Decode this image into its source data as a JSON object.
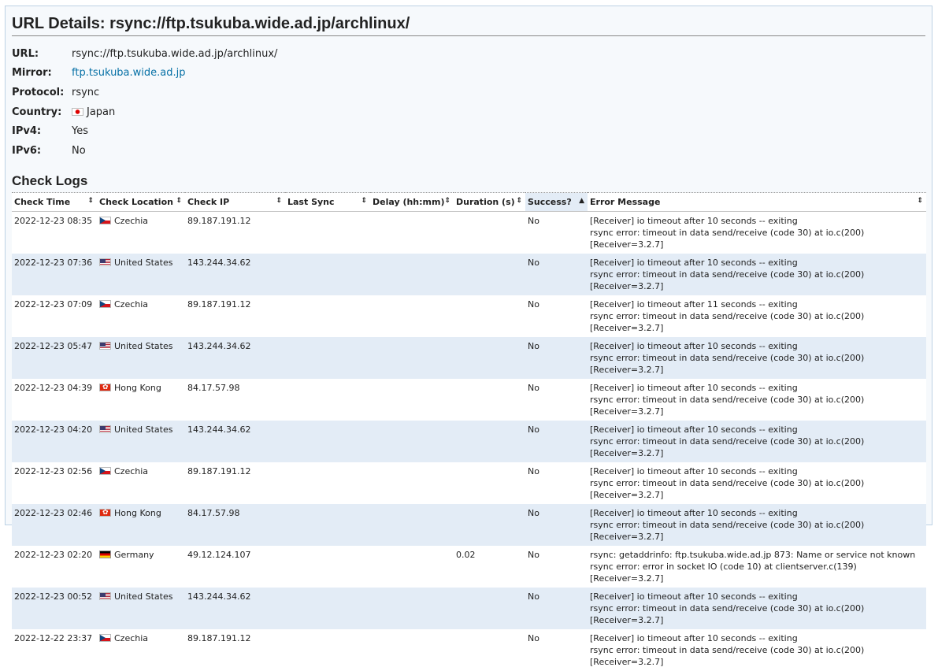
{
  "title": "URL Details: rsync://ftp.tsukuba.wide.ad.jp/archlinux/",
  "details": {
    "url_label": "URL:",
    "url": "rsync://ftp.tsukuba.wide.ad.jp/archlinux/",
    "mirror_label": "Mirror:",
    "mirror": "ftp.tsukuba.wide.ad.jp",
    "protocol_label": "Protocol:",
    "protocol": "rsync",
    "country_label": "Country:",
    "country": "Japan",
    "country_flag": "jp-flag-icon",
    "ipv4_label": "IPv4:",
    "ipv4": "Yes",
    "ipv6_label": "IPv6:",
    "ipv6": "No"
  },
  "check_logs": {
    "title": "Check Logs",
    "columns": [
      "Check Time",
      "Check Location",
      "Check IP",
      "Last Sync",
      "Delay (hh:mm)",
      "Duration (s)",
      "Success?",
      "Error Message"
    ],
    "sort_icon": "⇕ / ▲",
    "rows": [
      {
        "time": "2022-12-23 08:35",
        "flag": "cz",
        "location": "Czechia",
        "ip": "89.187.191.12",
        "last_sync": "",
        "delay": "",
        "duration": "",
        "success": "No",
        "err1": "[Receiver] io timeout after 10 seconds -- exiting",
        "err2": "rsync error: timeout in data send/receive (code 30) at io.c(200) [Receiver=3.2.7]"
      },
      {
        "time": "2022-12-23 07:36",
        "flag": "us",
        "location": "United States",
        "ip": "143.244.34.62",
        "last_sync": "",
        "delay": "",
        "duration": "",
        "success": "No",
        "err1": "[Receiver] io timeout after 10 seconds -- exiting",
        "err2": "rsync error: timeout in data send/receive (code 30) at io.c(200) [Receiver=3.2.7]"
      },
      {
        "time": "2022-12-23 07:09",
        "flag": "cz",
        "location": "Czechia",
        "ip": "89.187.191.12",
        "last_sync": "",
        "delay": "",
        "duration": "",
        "success": "No",
        "err1": "[Receiver] io timeout after 11 seconds -- exiting",
        "err2": "rsync error: timeout in data send/receive (code 30) at io.c(200) [Receiver=3.2.7]"
      },
      {
        "time": "2022-12-23 05:47",
        "flag": "us",
        "location": "United States",
        "ip": "143.244.34.62",
        "last_sync": "",
        "delay": "",
        "duration": "",
        "success": "No",
        "err1": "[Receiver] io timeout after 10 seconds -- exiting",
        "err2": "rsync error: timeout in data send/receive (code 30) at io.c(200) [Receiver=3.2.7]"
      },
      {
        "time": "2022-12-23 04:39",
        "flag": "hk",
        "location": "Hong Kong",
        "ip": "84.17.57.98",
        "last_sync": "",
        "delay": "",
        "duration": "",
        "success": "No",
        "err1": "[Receiver] io timeout after 10 seconds -- exiting",
        "err2": "rsync error: timeout in data send/receive (code 30) at io.c(200) [Receiver=3.2.7]"
      },
      {
        "time": "2022-12-23 04:20",
        "flag": "us",
        "location": "United States",
        "ip": "143.244.34.62",
        "last_sync": "",
        "delay": "",
        "duration": "",
        "success": "No",
        "err1": "[Receiver] io timeout after 10 seconds -- exiting",
        "err2": "rsync error: timeout in data send/receive (code 30) at io.c(200) [Receiver=3.2.7]"
      },
      {
        "time": "2022-12-23 02:56",
        "flag": "cz",
        "location": "Czechia",
        "ip": "89.187.191.12",
        "last_sync": "",
        "delay": "",
        "duration": "",
        "success": "No",
        "err1": "[Receiver] io timeout after 10 seconds -- exiting",
        "err2": "rsync error: timeout in data send/receive (code 30) at io.c(200) [Receiver=3.2.7]"
      },
      {
        "time": "2022-12-23 02:46",
        "flag": "hk",
        "location": "Hong Kong",
        "ip": "84.17.57.98",
        "last_sync": "",
        "delay": "",
        "duration": "",
        "success": "No",
        "err1": "[Receiver] io timeout after 10 seconds -- exiting",
        "err2": "rsync error: timeout in data send/receive (code 30) at io.c(200) [Receiver=3.2.7]"
      },
      {
        "time": "2022-12-23 02:20",
        "flag": "de",
        "location": "Germany",
        "ip": "49.12.124.107",
        "last_sync": "",
        "delay": "",
        "duration": "0.02",
        "success": "No",
        "err1": "rsync: getaddrinfo: ftp.tsukuba.wide.ad.jp 873: Name or service not known",
        "err2": "rsync error: error in socket IO (code 10) at clientserver.c(139) [Receiver=3.2.7]"
      },
      {
        "time": "2022-12-23 00:52",
        "flag": "us",
        "location": "United States",
        "ip": "143.244.34.62",
        "last_sync": "",
        "delay": "",
        "duration": "",
        "success": "No",
        "err1": "[Receiver] io timeout after 10 seconds -- exiting",
        "err2": "rsync error: timeout in data send/receive (code 30) at io.c(200) [Receiver=3.2.7]"
      },
      {
        "time": "2022-12-22 23:37",
        "flag": "cz",
        "location": "Czechia",
        "ip": "89.187.191.12",
        "last_sync": "",
        "delay": "",
        "duration": "",
        "success": "No",
        "err1": "[Receiver] io timeout after 10 seconds -- exiting",
        "err2": "rsync error: timeout in data send/receive (code 30) at io.c(200) [Receiver=3.2.7]"
      }
    ]
  }
}
